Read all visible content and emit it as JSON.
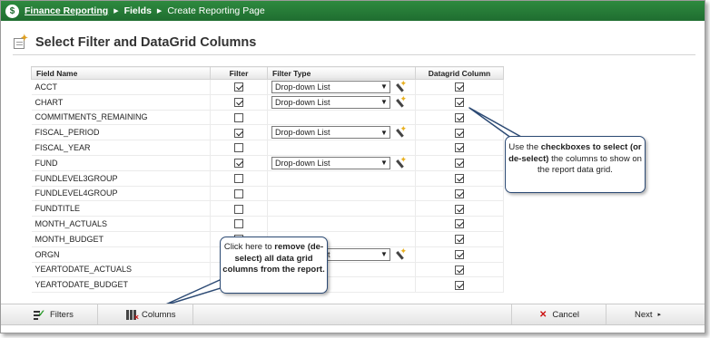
{
  "topbar": {
    "logo": "$",
    "crumb1": "Finance Reporting",
    "crumb2": "Fields",
    "crumb3": "Create Reporting Page",
    "sep": "▶"
  },
  "page": {
    "title": "Select Filter and DataGrid Columns"
  },
  "grid": {
    "headers": {
      "field": "Field Name",
      "filter": "Filter",
      "ftype": "Filter Type",
      "dg": "Datagrid Column"
    },
    "rows": [
      {
        "name": "ACCT",
        "filter": true,
        "ftype": "Drop-down List",
        "dg": true
      },
      {
        "name": "CHART",
        "filter": true,
        "ftype": "Drop-down List",
        "dg": true
      },
      {
        "name": "COMMITMENTS_REMAINING",
        "filter": false,
        "ftype": "",
        "dg": true
      },
      {
        "name": "FISCAL_PERIOD",
        "filter": true,
        "ftype": "Drop-down List",
        "dg": true
      },
      {
        "name": "FISCAL_YEAR",
        "filter": false,
        "ftype": "",
        "dg": true
      },
      {
        "name": "FUND",
        "filter": true,
        "ftype": "Drop-down List",
        "dg": true
      },
      {
        "name": "FUNDLEVEL3GROUP",
        "filter": false,
        "ftype": "",
        "dg": true
      },
      {
        "name": "FUNDLEVEL4GROUP",
        "filter": false,
        "ftype": "",
        "dg": true
      },
      {
        "name": "FUNDTITLE",
        "filter": false,
        "ftype": "",
        "dg": true
      },
      {
        "name": "MONTH_ACTUALS",
        "filter": false,
        "ftype": "",
        "dg": true
      },
      {
        "name": "MONTH_BUDGET",
        "filter": false,
        "ftype": "",
        "dg": true
      },
      {
        "name": "ORGN",
        "filter": true,
        "ftype": "Drop-down List",
        "dg": true
      },
      {
        "name": "YEARTODATE_ACTUALS",
        "filter": false,
        "ftype": "",
        "dg": true
      },
      {
        "name": "YEARTODATE_BUDGET",
        "filter": false,
        "ftype": "",
        "dg": true
      }
    ]
  },
  "callout1": {
    "t1": "Use the ",
    "b1": "checkboxes to select (or de-select)",
    "t2": " the columns to show on the report data grid."
  },
  "callout2": {
    "t1": "Click here to ",
    "b1": "remove (de-select) all data grid columns from the report."
  },
  "bottombar": {
    "filters": "Filters",
    "columns": "Columns",
    "cancel": "Cancel",
    "next": "Next",
    "next_arrow": "▸"
  },
  "icons": {
    "logo": "dollar-logo-icon",
    "title": "page-add-icon",
    "wand": "magic-wand-icon",
    "filters": "filter-check-icon",
    "columns": "columns-remove-icon",
    "cancel": "cancel-x-icon"
  },
  "colors": {
    "topbar": "#1f6d30",
    "callout_border": "#2c4a74",
    "cancel_icon": "#cc1111"
  }
}
